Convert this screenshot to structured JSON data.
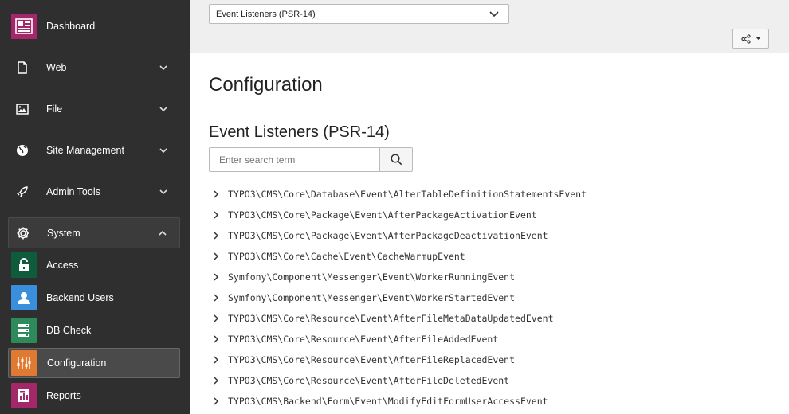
{
  "sidebar": {
    "main_items": [
      {
        "label": "Dashboard",
        "icon": "dashboard-icon"
      },
      {
        "label": "Web",
        "icon": "web-page-icon"
      },
      {
        "label": "File",
        "icon": "file-image-icon"
      },
      {
        "label": "Site Management",
        "icon": "globe-icon"
      },
      {
        "label": "Admin Tools",
        "icon": "rocket-icon"
      },
      {
        "label": "System",
        "icon": "gear-icon"
      }
    ],
    "system_items": [
      {
        "label": "Access",
        "icon": "padlock-icon",
        "color": "#0f5c3c"
      },
      {
        "label": "Backend Users",
        "icon": "user-icon",
        "color": "#3a8fdc"
      },
      {
        "label": "DB Check",
        "icon": "database-icon",
        "color": "#2e8a5a"
      },
      {
        "label": "Configuration",
        "icon": "sliders-icon",
        "color": "#e07a32"
      },
      {
        "label": "Reports",
        "icon": "report-icon",
        "color": "#a4276a"
      }
    ]
  },
  "topbar": {
    "selected_option": "Event Listeners (PSR-14)"
  },
  "main": {
    "title": "Configuration",
    "subtitle": "Event Listeners (PSR-14)",
    "search_placeholder": "Enter search term",
    "events": [
      "TYPO3\\CMS\\Core\\Database\\Event\\AlterTableDefinitionStatementsEvent",
      "TYPO3\\CMS\\Core\\Package\\Event\\AfterPackageActivationEvent",
      "TYPO3\\CMS\\Core\\Package\\Event\\AfterPackageDeactivationEvent",
      "TYPO3\\CMS\\Core\\Cache\\Event\\CacheWarmupEvent",
      "Symfony\\Component\\Messenger\\Event\\WorkerRunningEvent",
      "Symfony\\Component\\Messenger\\Event\\WorkerStartedEvent",
      "TYPO3\\CMS\\Core\\Resource\\Event\\AfterFileMetaDataUpdatedEvent",
      "TYPO3\\CMS\\Core\\Resource\\Event\\AfterFileAddedEvent",
      "TYPO3\\CMS\\Core\\Resource\\Event\\AfterFileReplacedEvent",
      "TYPO3\\CMS\\Core\\Resource\\Event\\AfterFileDeletedEvent",
      "TYPO3\\CMS\\Backend\\Form\\Event\\ModifyEditFormUserAccessEvent"
    ]
  }
}
